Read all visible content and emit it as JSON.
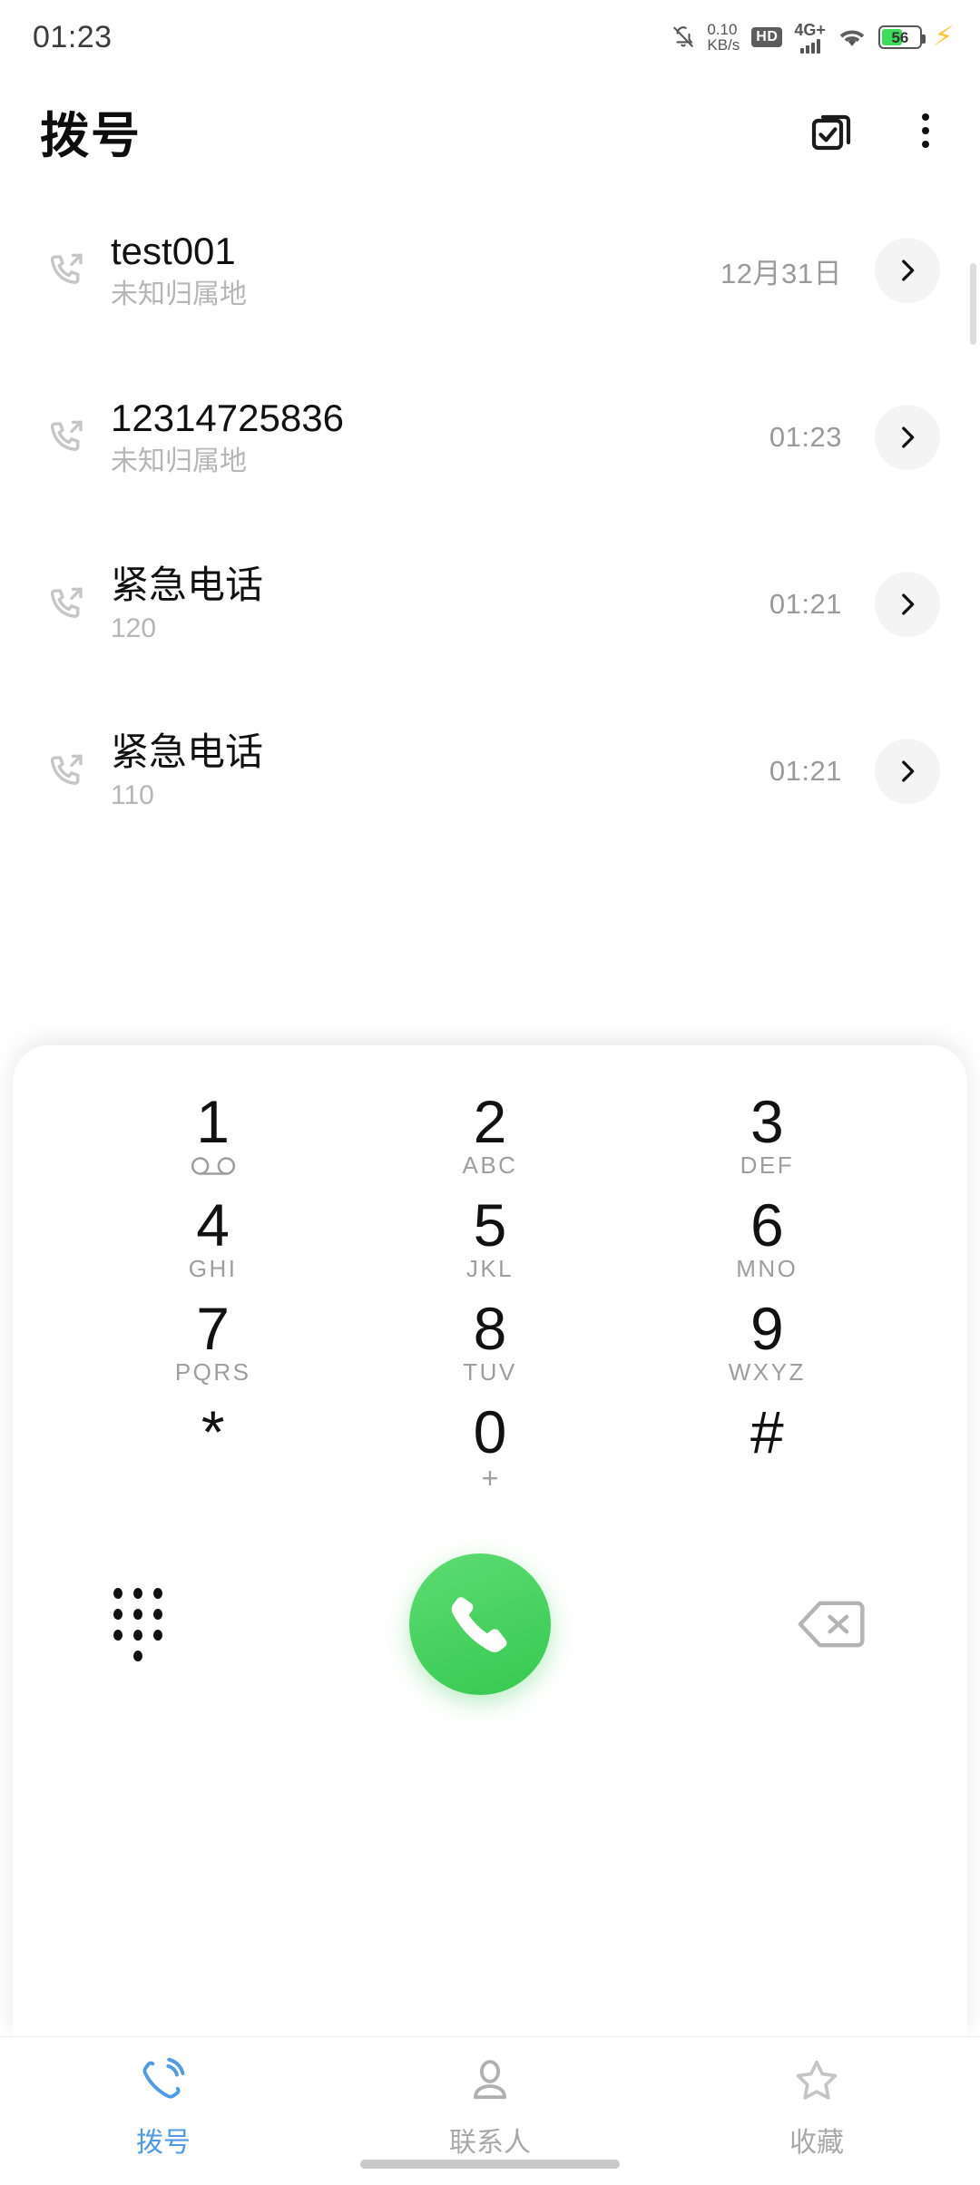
{
  "status_bar": {
    "clock": "01:23",
    "net_speed_value": "0.10",
    "net_speed_unit": "KB/s",
    "hd_badge": "HD",
    "network_type": "4G+",
    "signal_bars": 4,
    "battery_percent": "56",
    "battery_level": 56,
    "icons": {
      "mute": "bell-muted-icon",
      "hd": "hd-icon",
      "network": "network-4gplus-icon",
      "wifi": "wifi-icon",
      "battery": "battery-icon",
      "charging": "charging-bolt-icon"
    },
    "colors": {
      "battery_fill": "#3ddc5a",
      "charging_bolt": "#fcc82e",
      "icon": "#555555"
    }
  },
  "header": {
    "title": "拨号",
    "multiselect_label": "multi-select",
    "overflow_label": "more-options"
  },
  "call_log": {
    "entries": [
      {
        "name": "test001",
        "sub": "未知归属地",
        "time": "12月31日",
        "type": "outgoing"
      },
      {
        "name": "12314725836",
        "sub": "未知归属地",
        "time": "01:23",
        "type": "outgoing"
      },
      {
        "name": "紧急电话",
        "sub": "120",
        "time": "01:21",
        "type": "outgoing"
      },
      {
        "name": "紧急电话",
        "sub": "110",
        "time": "01:21",
        "type": "outgoing"
      }
    ]
  },
  "dialpad": {
    "keys": [
      {
        "digit": "1",
        "sub": "",
        "icon": "voicemail-icon"
      },
      {
        "digit": "2",
        "sub": "ABC",
        "icon": ""
      },
      {
        "digit": "3",
        "sub": "DEF",
        "icon": ""
      },
      {
        "digit": "4",
        "sub": "GHI",
        "icon": ""
      },
      {
        "digit": "5",
        "sub": "JKL",
        "icon": ""
      },
      {
        "digit": "6",
        "sub": "MNO",
        "icon": ""
      },
      {
        "digit": "7",
        "sub": "PQRS",
        "icon": ""
      },
      {
        "digit": "8",
        "sub": "TUV",
        "icon": ""
      },
      {
        "digit": "9",
        "sub": "WXYZ",
        "icon": ""
      },
      {
        "digit": "*",
        "sub": "",
        "icon": ""
      },
      {
        "digit": "0",
        "sub": "+",
        "icon": ""
      },
      {
        "digit": "#",
        "sub": "",
        "icon": ""
      }
    ],
    "actions": {
      "hide_keypad_label": "hide-keypad",
      "call_label": "call",
      "backspace_label": "backspace",
      "call_button_color": "#36c950"
    }
  },
  "bottom_nav": {
    "items": [
      {
        "label": "拨号",
        "icon": "dialer-icon",
        "active": true
      },
      {
        "label": "联系人",
        "icon": "contacts-icon",
        "active": false
      },
      {
        "label": "收藏",
        "icon": "star-icon",
        "active": false
      }
    ],
    "active_color": "#4d9ae8",
    "inactive_color": "#a8a8a8"
  }
}
